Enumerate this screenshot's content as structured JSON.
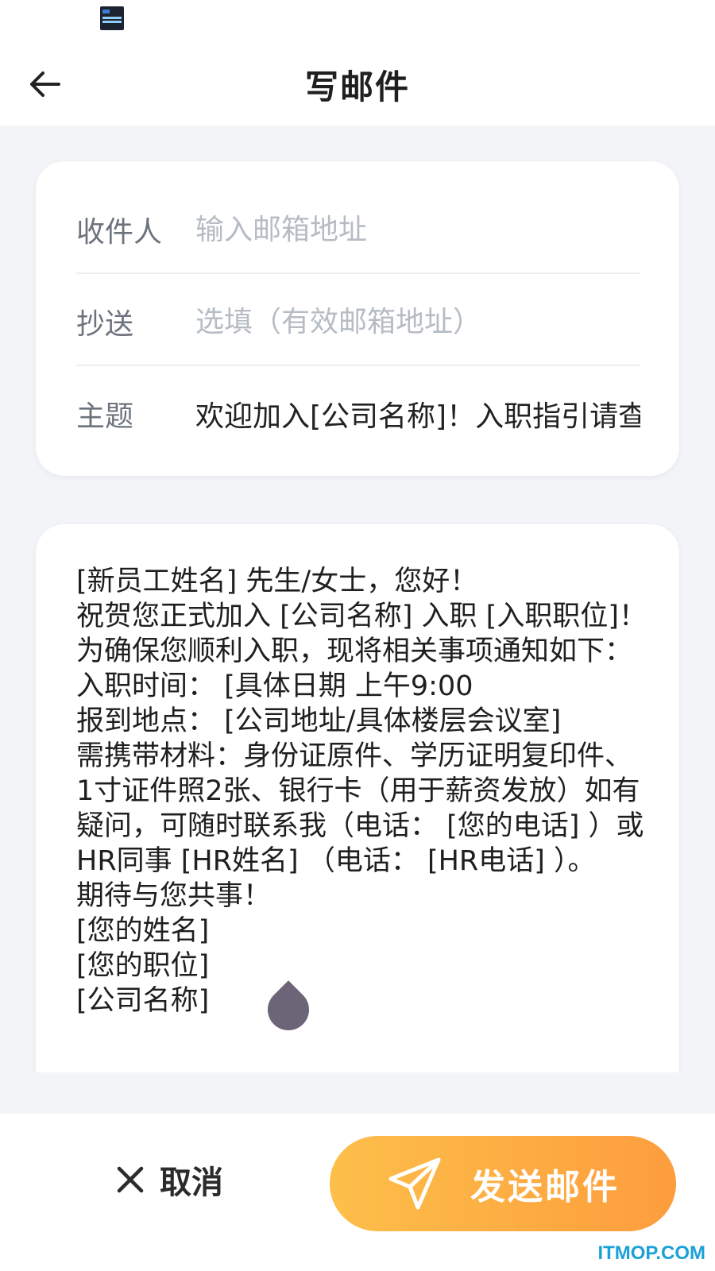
{
  "header": {
    "title": "写邮件"
  },
  "fields": {
    "to": {
      "label": "收件人",
      "placeholder": "输入邮箱地址",
      "value": ""
    },
    "cc": {
      "label": "抄送",
      "placeholder": "选填（有效邮箱地址）",
      "value": ""
    },
    "subject": {
      "label": "主题",
      "placeholder": "",
      "value": "欢迎加入[公司名称]！入职指引请查"
    }
  },
  "body": {
    "text": "[新员工姓名] 先生/女士，您好！\n祝贺您正式加入 [公司名称] 入职 [入职职位]！为确保您顺利入职，现将相关事项通知如下：\n入职时间： [具体日期 上午9:00\n报到地点： [公司地址/具体楼层会议室]\n需携带材料：身份证原件、学历证明复印件、1寸证件照2张、银行卡（用于薪资发放）如有疑问，可随时联系我（电话： [您的电话] ）或HR同事 [HR姓名] （电话： [HR电话] ）。\n期待与您共事！\n[您的姓名]\n[您的职位]\n[公司名称]"
  },
  "footer": {
    "cancel_label": "取消",
    "send_label": "发送邮件"
  },
  "watermark": "ITMOP.COM",
  "colors": {
    "accent_start": "#fdbf4a",
    "accent_end": "#fd9d3d",
    "background": "#f2f4f8"
  }
}
